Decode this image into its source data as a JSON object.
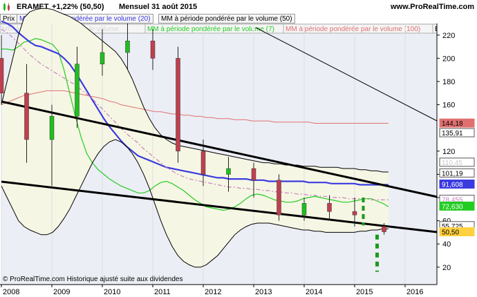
{
  "header": {
    "ticker": "ERAMET",
    "change": "+1,22% (50,50)",
    "period": "Mensuel   31 août 2015",
    "brand": "www.ProRealTime.com"
  },
  "legend": {
    "prix": "Prix",
    "mm20": "MM à période pondérée par le volume (20)",
    "mm50": "MM à période pondérée par le volume (50)",
    "mm_ghost": "MM à période pondérée par le volume",
    "mm7": "MM à période pondérée par le volume (7)",
    "mm100": "MM à période pondérée par le volume (100)",
    "trunc": "E"
  },
  "copyright": "© ProRealTime.com  Historique ajusté suite aux dividendes",
  "colors": {
    "up": "#1fbf1f",
    "down": "#c0404e",
    "mm7": "#22cc22",
    "mm20": "#3a3ae0",
    "mm50": "#c880c0",
    "mm100": "#e07070",
    "bb": "#000000",
    "band_fill": "#f6f6e4",
    "plot_bg": "#ebeef4"
  },
  "chart_data": {
    "type": "candlestick",
    "y_axis": {
      "ticks": [
        "220",
        "200",
        "180",
        "160",
        "120",
        "100",
        "80",
        "60",
        "40",
        "20"
      ],
      "ylim": [
        5,
        230
      ]
    },
    "x_axis": {
      "ticks": [
        "2008",
        "2009",
        "2010",
        "2011",
        "2012",
        "2013",
        "2014",
        "2015",
        "2016"
      ]
    },
    "price_labels": [
      {
        "value": "144,18",
        "color": "#e07070",
        "text_color": "#000000"
      },
      {
        "value": "135,91",
        "color": "#ffffff",
        "text_color": "#000000"
      },
      {
        "value": "110,45",
        "color": "#ffffff",
        "text_color": "#c8c8c8"
      },
      {
        "value": "101,19",
        "color": "#ffffff",
        "text_color": "#000000"
      },
      {
        "value": "91,608",
        "color": "#3a3ae0",
        "text_color": "#3a3ae0"
      },
      {
        "value": "78,455",
        "color": "#ffffff",
        "text_color": "#c880c0"
      },
      {
        "value": "72,630",
        "color": "#22cc22",
        "text_color": "#22cc22"
      },
      {
        "value": "55,725",
        "color": "#ffffff",
        "text_color": "#000000"
      },
      {
        "value": "50,50",
        "color": "#ffd040",
        "text_color": "#000000"
      }
    ],
    "series": [
      {
        "name": "MM à période pondérée par le volume (7)",
        "values": [
          208,
          208,
          207,
          210,
          214,
          215,
          217,
          216,
          214,
          212,
          206,
          190,
          170,
          150,
          132,
          118,
          110,
          104,
          100,
          96,
          93,
          90,
          88,
          86,
          84,
          84,
          86,
          90,
          93,
          94,
          92,
          89,
          86,
          82,
          78,
          75,
          72,
          71,
          70,
          69,
          70,
          72,
          75,
          79,
          82,
          83,
          82,
          80,
          78,
          77,
          76,
          76,
          77,
          79,
          80,
          81,
          80,
          79,
          78,
          77,
          76,
          76,
          77,
          78,
          79,
          79,
          77,
          75,
          72
        ]
      },
      {
        "name": "MM à période pondérée par le volume (20)",
        "values": [
          232,
          230,
          227,
          222,
          218,
          214,
          211,
          210,
          208,
          206,
          204,
          200,
          195,
          188,
          180,
          172,
          164,
          156,
          148,
          141,
          135,
          129,
          124,
          120,
          116,
          114,
          112,
          110,
          108,
          106,
          105,
          104,
          103,
          102,
          101,
          100,
          99,
          98,
          97,
          97,
          96,
          96,
          96,
          96,
          95,
          95,
          95,
          94,
          94,
          94,
          94,
          94,
          94,
          94,
          93,
          93,
          93,
          93,
          92,
          92,
          92,
          92,
          92,
          91,
          91,
          91,
          91,
          91,
          91
        ]
      },
      {
        "name": "MM à période pondérée par le volume (50)",
        "values": [
          225,
          222,
          218,
          213,
          208,
          203,
          199,
          195,
          192,
          189,
          186,
          183,
          180,
          177,
          173,
          169,
          165,
          160,
          155,
          150,
          145,
          140,
          135,
          131,
          127,
          122,
          118,
          114,
          110,
          106,
          103,
          100,
          98,
          96,
          95,
          94,
          93,
          92,
          91,
          90,
          89,
          89,
          88,
          88,
          87,
          87,
          86,
          86,
          85,
          85,
          84,
          84,
          83,
          83,
          82,
          82,
          81,
          81,
          80,
          80,
          80,
          79,
          79,
          79,
          79,
          78,
          78,
          78,
          78
        ]
      },
      {
        "name": "MM à période pondérée par le volume (100)",
        "values": [
          160,
          162,
          164,
          166,
          168,
          169,
          170,
          171,
          172,
          172,
          172,
          172,
          171,
          170,
          169,
          168,
          167,
          166,
          165,
          163,
          162,
          160,
          159,
          158,
          157,
          156,
          155,
          154,
          154,
          153,
          152,
          152,
          151,
          151,
          150,
          150,
          149,
          149,
          148,
          148,
          148,
          147,
          147,
          147,
          146,
          146,
          146,
          146,
          145,
          145,
          145,
          145,
          145,
          145,
          145,
          144,
          144,
          144,
          144,
          144,
          144,
          144,
          144,
          144,
          144,
          144,
          144,
          144,
          144
        ]
      },
      {
        "name": "Bollinger Bands (upper)",
        "values": [
          160,
          180,
          200,
          220,
          235,
          240,
          242,
          243,
          243,
          242,
          240,
          238,
          236,
          233,
          230,
          226,
          222,
          218,
          214,
          210,
          206,
          200,
          192,
          182,
          170,
          158,
          148,
          140,
          134,
          130,
          127,
          125,
          124,
          123,
          122,
          121,
          120,
          119,
          118,
          117,
          116,
          115,
          114,
          113,
          112,
          111,
          110,
          110,
          109,
          109,
          108,
          108,
          108,
          107,
          107,
          107,
          106,
          106,
          106,
          106,
          105,
          105,
          105,
          104,
          104,
          103,
          103,
          102,
          102
        ]
      },
      {
        "name": "Bollinger Bands (lower)",
        "values": [
          90,
          80,
          70,
          60,
          55,
          52,
          50,
          48,
          48,
          50,
          55,
          62,
          70,
          80,
          90,
          100,
          110,
          118,
          124,
          128,
          130,
          128,
          124,
          118,
          110,
          100,
          88,
          74,
          60,
          48,
          38,
          30,
          25,
          22,
          20,
          20,
          22,
          26,
          30,
          36,
          42,
          48,
          52,
          55,
          57,
          58,
          58,
          58,
          57,
          56,
          55,
          54,
          53,
          52,
          52,
          51,
          51,
          50,
          50,
          50,
          50,
          50,
          50,
          51,
          51,
          52,
          52,
          53,
          53
        ]
      }
    ],
    "candles": [
      {
        "t": "2008-01",
        "o": 200,
        "h": 220,
        "l": 160,
        "c": 170
      },
      {
        "t": "2008-07",
        "o": 170,
        "h": 195,
        "l": 110,
        "c": 130
      },
      {
        "t": "2009-01",
        "o": 130,
        "h": 160,
        "l": 90,
        "c": 150
      },
      {
        "t": "2009-07",
        "o": 150,
        "h": 210,
        "l": 140,
        "c": 195
      },
      {
        "t": "2010-01",
        "o": 195,
        "h": 225,
        "l": 185,
        "c": 205
      },
      {
        "t": "2010-07",
        "o": 205,
        "h": 230,
        "l": 190,
        "c": 215
      },
      {
        "t": "2011-01",
        "o": 215,
        "h": 225,
        "l": 190,
        "c": 200
      },
      {
        "t": "2011-07",
        "o": 200,
        "h": 210,
        "l": 110,
        "c": 120
      },
      {
        "t": "2012-01",
        "o": 120,
        "h": 130,
        "l": 90,
        "c": 100
      },
      {
        "t": "2012-07",
        "o": 100,
        "h": 115,
        "l": 85,
        "c": 105
      },
      {
        "t": "2013-01",
        "o": 105,
        "h": 110,
        "l": 80,
        "c": 95
      },
      {
        "t": "2013-07",
        "o": 95,
        "h": 100,
        "l": 60,
        "c": 65
      },
      {
        "t": "2014-01",
        "o": 65,
        "h": 80,
        "l": 60,
        "c": 75
      },
      {
        "t": "2014-07",
        "o": 75,
        "h": 82,
        "l": 60,
        "c": 68
      },
      {
        "t": "2015-01",
        "o": 68,
        "h": 80,
        "l": 55,
        "c": 65
      },
      {
        "t": "2015-08",
        "o": 55,
        "h": 58,
        "l": 48,
        "c": 50.5
      }
    ]
  }
}
